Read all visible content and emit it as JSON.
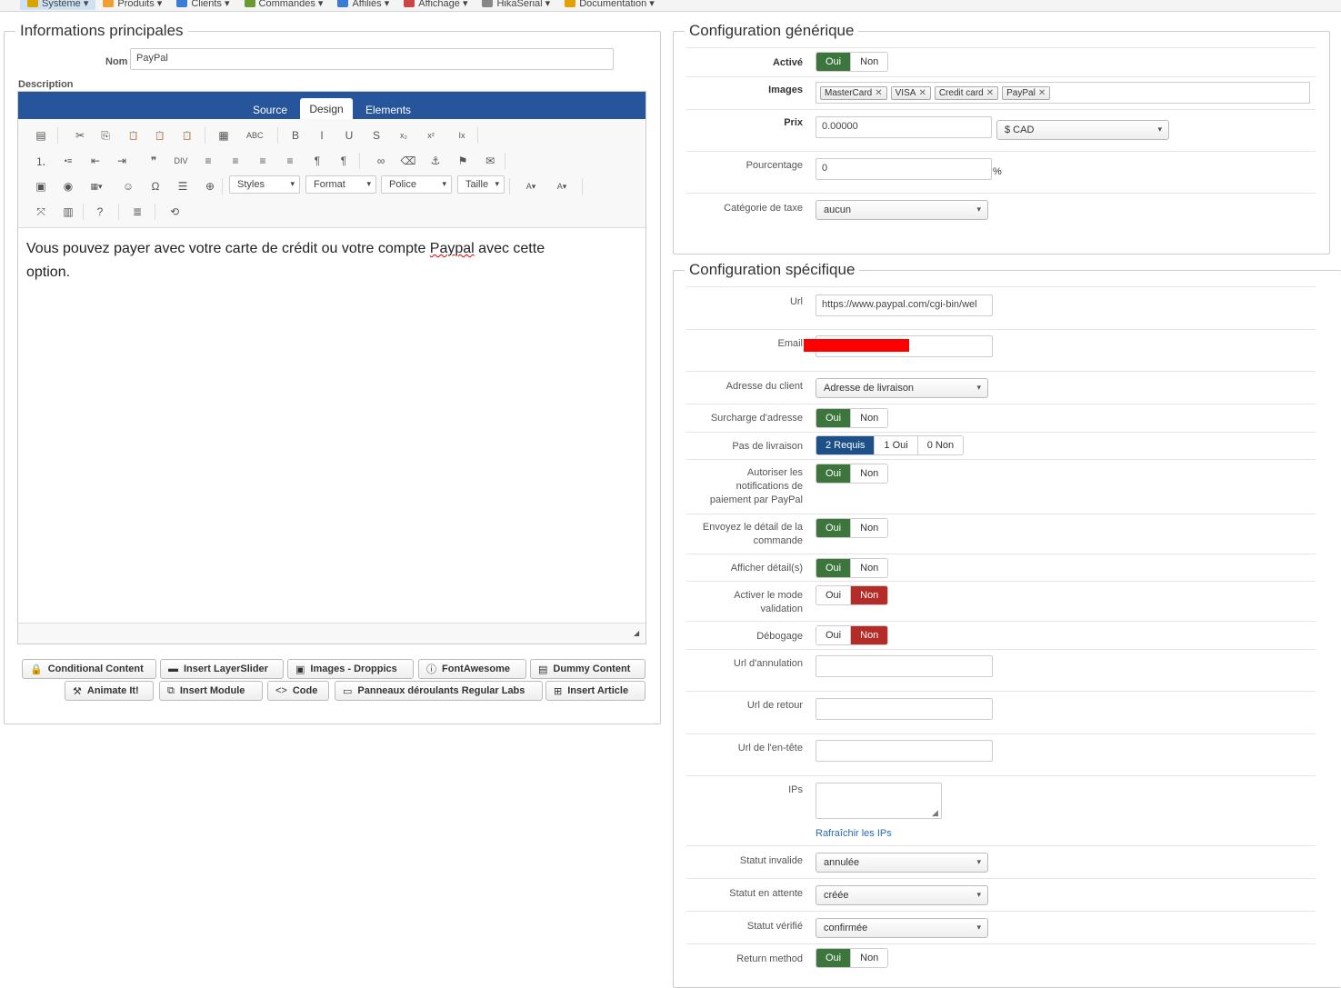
{
  "topbar": {
    "items": [
      {
        "label": "Système ▾",
        "icon": "wrench-icon",
        "color": "#d9a400"
      },
      {
        "label": "Produits ▾",
        "icon": "box-icon",
        "color": "#f0a030"
      },
      {
        "label": "Clients ▾",
        "icon": "users-icon",
        "color": "#3a7bd5"
      },
      {
        "label": "Commandes ▾",
        "icon": "cart-icon",
        "color": "#6a9a30"
      },
      {
        "label": "Affiliés ▾",
        "icon": "affiliate-icon",
        "color": "#3a7bd5"
      },
      {
        "label": "Affichage ▾",
        "icon": "display-icon",
        "color": "#c44"
      },
      {
        "label": "HikaSerial ▾",
        "icon": "serial-icon",
        "color": "#888"
      },
      {
        "label": "Documentation ▾",
        "icon": "docs-icon",
        "color": "#e6a000"
      }
    ]
  },
  "main": {
    "legend": "Informations principales",
    "name_label": "Nom",
    "name_value": "PayPal",
    "description_label": "Description",
    "editor": {
      "tabs": [
        "Source",
        "Design",
        "Elements"
      ],
      "toolbar_combos": [
        "Styles",
        "Format",
        "Police",
        "Taille"
      ],
      "content_line1": "Vous pouvez payer avec votre carte de crédit ou votre compte ",
      "content_link": "Paypal",
      "content_line2": " avec cette",
      "content_line3": "option."
    },
    "plugins_row1": [
      "Conditional Content",
      "Insert LayerSlider",
      "Images - Droppics",
      "FontAwesome",
      "Dummy Content"
    ],
    "plugins_row2": [
      "Animate It!",
      "Insert Module",
      "Code",
      "Panneaux déroulants Regular Labs",
      "Insert Article"
    ]
  },
  "generic": {
    "legend": "Configuration générique",
    "active_label": "Activé",
    "yes": "Oui",
    "no": "Non",
    "images_label": "Images",
    "images": [
      "MasterCard",
      "VISA",
      "Credit card",
      "PayPal"
    ],
    "price_label": "Prix",
    "price_value": "0.00000",
    "currency": "$ CAD",
    "percent_label": "Pourcentage",
    "percent_value": "0",
    "percent_sign": "%",
    "tax_label": "Catégorie de taxe",
    "tax_value": "aucun"
  },
  "specific": {
    "legend": "Configuration spécifique",
    "url_label": "Url",
    "url_value": "https://www.paypal.com/cgi-bin/wel",
    "email_label": "Email",
    "address_label": "Adresse du client",
    "address_value": "Adresse de livraison",
    "surcharge_label": "Surcharge d'adresse",
    "nodelivery_label": "Pas de livraison",
    "nodelivery_opts": [
      "2 Requis",
      "1 Oui",
      "0 Non"
    ],
    "notif_label": "Autoriser les notifications de paiement par PayPal",
    "send_detail_label": "Envoyez le détail de la commande",
    "show_detail_label": "Afficher détail(s)",
    "validation_label": "Activer le mode validation",
    "debug_label": "Débogage",
    "cancel_url_label": "Url d'annulation",
    "return_url_label": "Url de retour",
    "header_url_label": "Url de l'en-tête",
    "ips_label": "IPs",
    "refresh_ips": "Rafraîchir les IPs",
    "invalid_label": "Statut invalide",
    "invalid_value": "annulée",
    "pending_label": "Statut en attente",
    "pending_value": "créée",
    "verified_label": "Statut vérifié",
    "verified_value": "confirmée",
    "return_method_label": "Return method"
  }
}
